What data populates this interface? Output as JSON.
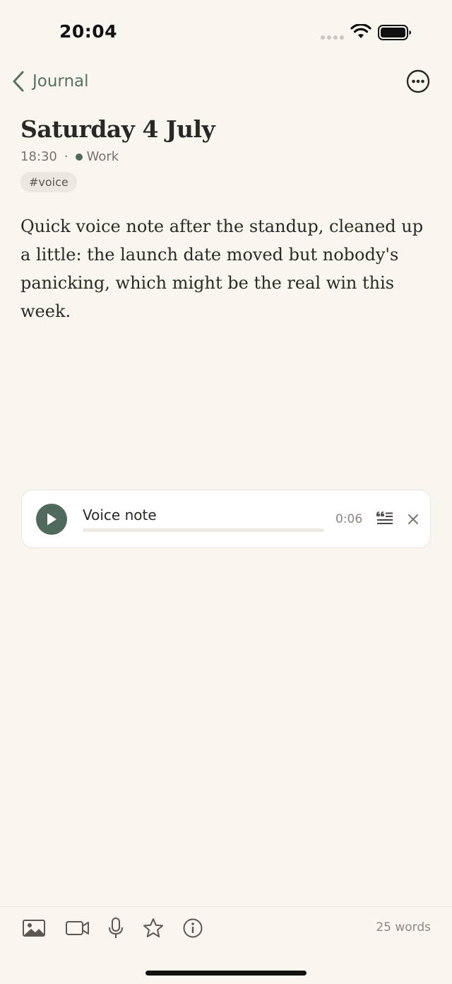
{
  "status_bar": {
    "time": "20:04"
  },
  "nav": {
    "back_label": "Journal",
    "back_icon": "chevron-left-icon",
    "more_icon": "ellipsis-circle-icon"
  },
  "entry": {
    "title": "Saturday 4 July",
    "time": "18:30",
    "separator": "·",
    "journal_name": "Work",
    "tag": "#voice",
    "body": "Quick voice note after the standup, cleaned up a little: the launch date moved but nobody's panicking, which might be the real win this week."
  },
  "voice_note": {
    "title": "Voice note",
    "duration": "0:06",
    "progress": 0
  },
  "toolbar": {
    "tools": [
      "photo-icon",
      "video-icon",
      "microphone-icon",
      "star-icon",
      "info-icon"
    ],
    "word_count": "25 words"
  },
  "colors": {
    "background": "#f9f6f0",
    "accent": "#4f6a5c",
    "text": "#2b2926",
    "muted": "#77736c"
  }
}
